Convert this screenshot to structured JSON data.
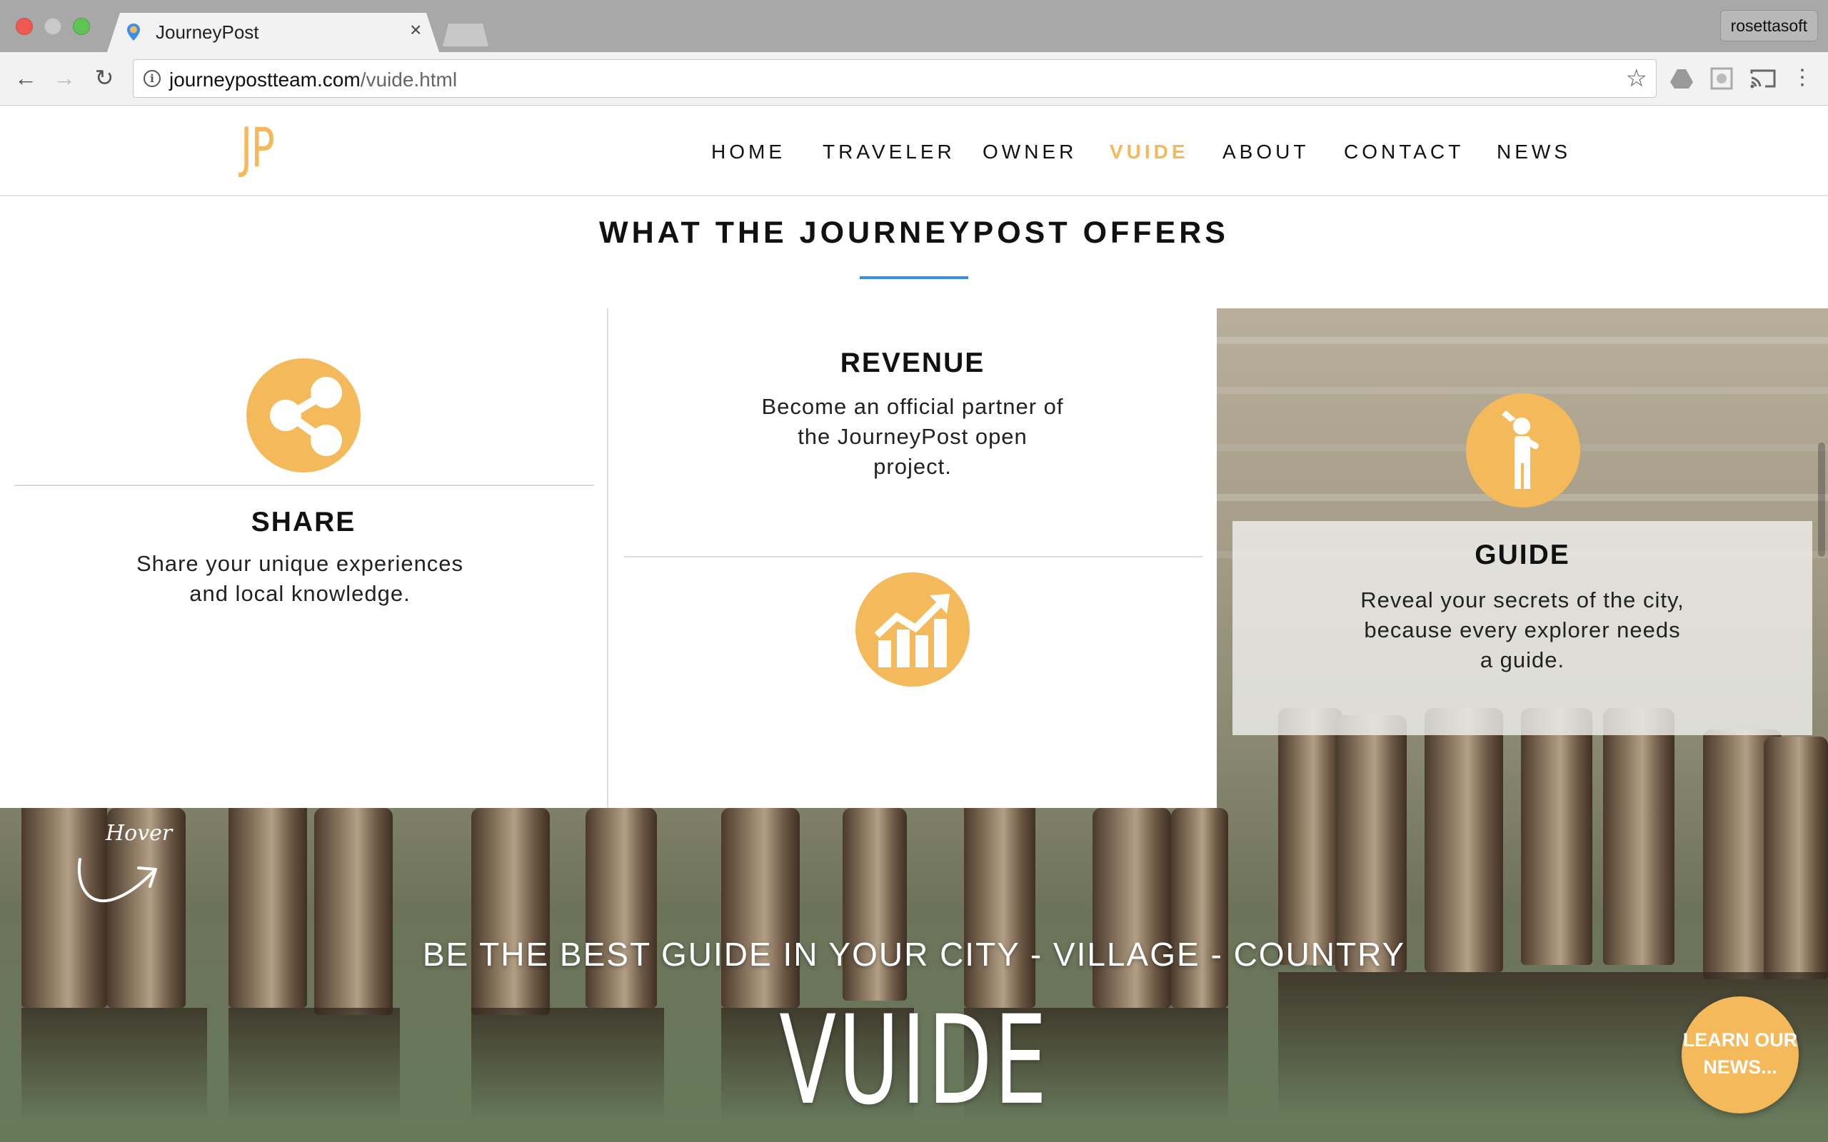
{
  "browser": {
    "tab_title": "JourneyPost",
    "profile_name": "rosettasoft",
    "url_domain": "journeypostteam.com",
    "url_path": "/vuide.html",
    "info_icon_glyph": "i"
  },
  "site": {
    "logo": "JP",
    "accent_color": "#f4b95a",
    "nav": [
      {
        "label": "HOME"
      },
      {
        "label": "TRAVELER"
      },
      {
        "label": "OWNER"
      },
      {
        "label": "VUIDE",
        "active": true
      },
      {
        "label": "ABOUT"
      },
      {
        "label": "CONTACT"
      },
      {
        "label": "NEWS"
      }
    ]
  },
  "offers": {
    "title": "WHAT THE JOURNEYPOST OFFERS",
    "cards": [
      {
        "heading": "SHARE",
        "line1": "Share your unique experiences",
        "line2": "and local knowledge.",
        "icon": "share-icon"
      },
      {
        "heading": "REVENUE",
        "line1": "Become an official partner of",
        "line2": "the JourneyPost open",
        "line3": "project.",
        "icon": "growth-chart-icon"
      },
      {
        "heading": "GUIDE",
        "line1": "Reveal your secrets of the city,",
        "line2": "because every explorer needs",
        "line3": "a guide.",
        "icon": "guide-person-icon"
      }
    ]
  },
  "hero": {
    "hover_note": "Hover",
    "tagline": "BE THE BEST GUIDE IN YOUR CITY - VILLAGE - COUNTRY",
    "title": "VUIDE",
    "news_button_line1": "LEARN OUR",
    "news_button_line2": "NEWS..."
  }
}
